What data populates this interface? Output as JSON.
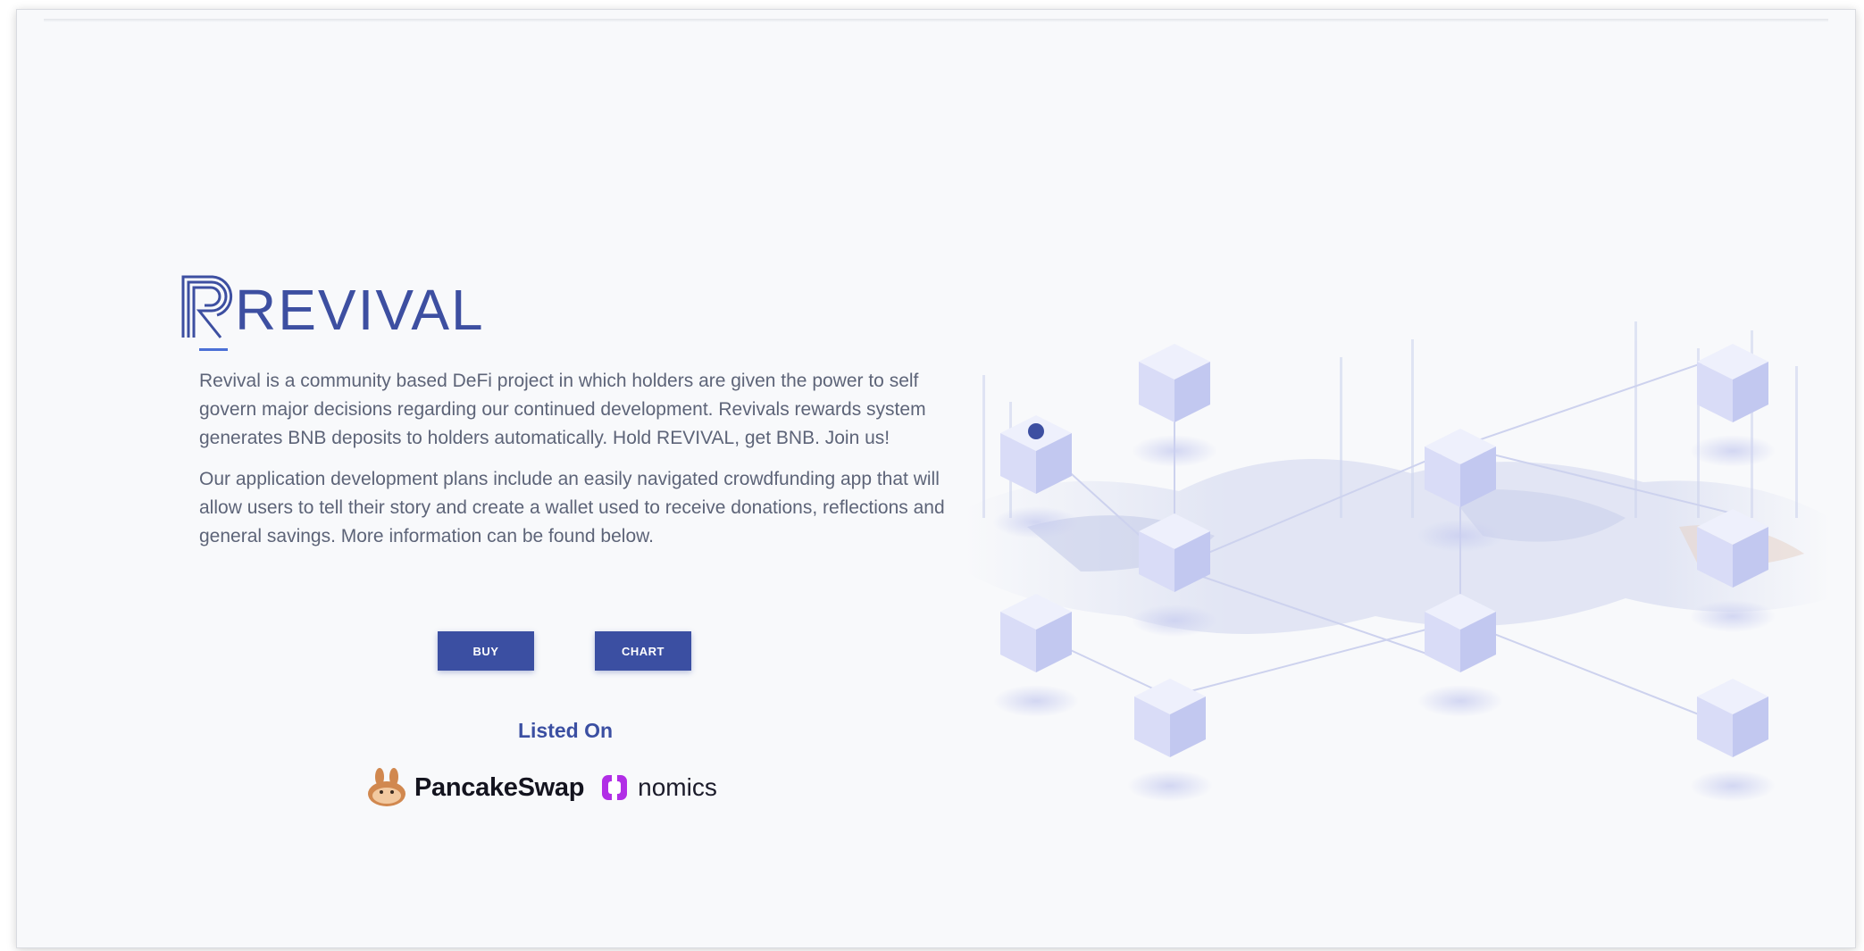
{
  "brand": {
    "name": "REVIVAL",
    "accent": "#3d4fa1",
    "underline_color": "#4b70d6"
  },
  "hero": {
    "paragraph1": "Revival is a community based DeFi project in which holders are given the power to self govern major decisions regarding our continued development. Revivals rewards system generates BNB deposits to holders automatically. Hold REVIVAL, get BNB. Join us!",
    "paragraph2": "Our application development plans include an easily navigated crowdfunding app that will allow users to tell their story and create a wallet used to receive donations, reflections and general savings. More information can be found below."
  },
  "buttons": {
    "buy_label": "BUY",
    "chart_label": "CHART",
    "color": "#3b4fa2"
  },
  "listed": {
    "heading": "Listed On",
    "partners": [
      {
        "name": "PancakeSwap",
        "icon": "pancakeswap-bunny-icon",
        "color": "#d1884f"
      },
      {
        "name": "nomics",
        "icon": "nomics-logo-icon",
        "color": "#b12ee6"
      }
    ]
  },
  "illustration": {
    "icon": "blockchain-network-illustration",
    "cube_color": "#d9dcf7"
  }
}
